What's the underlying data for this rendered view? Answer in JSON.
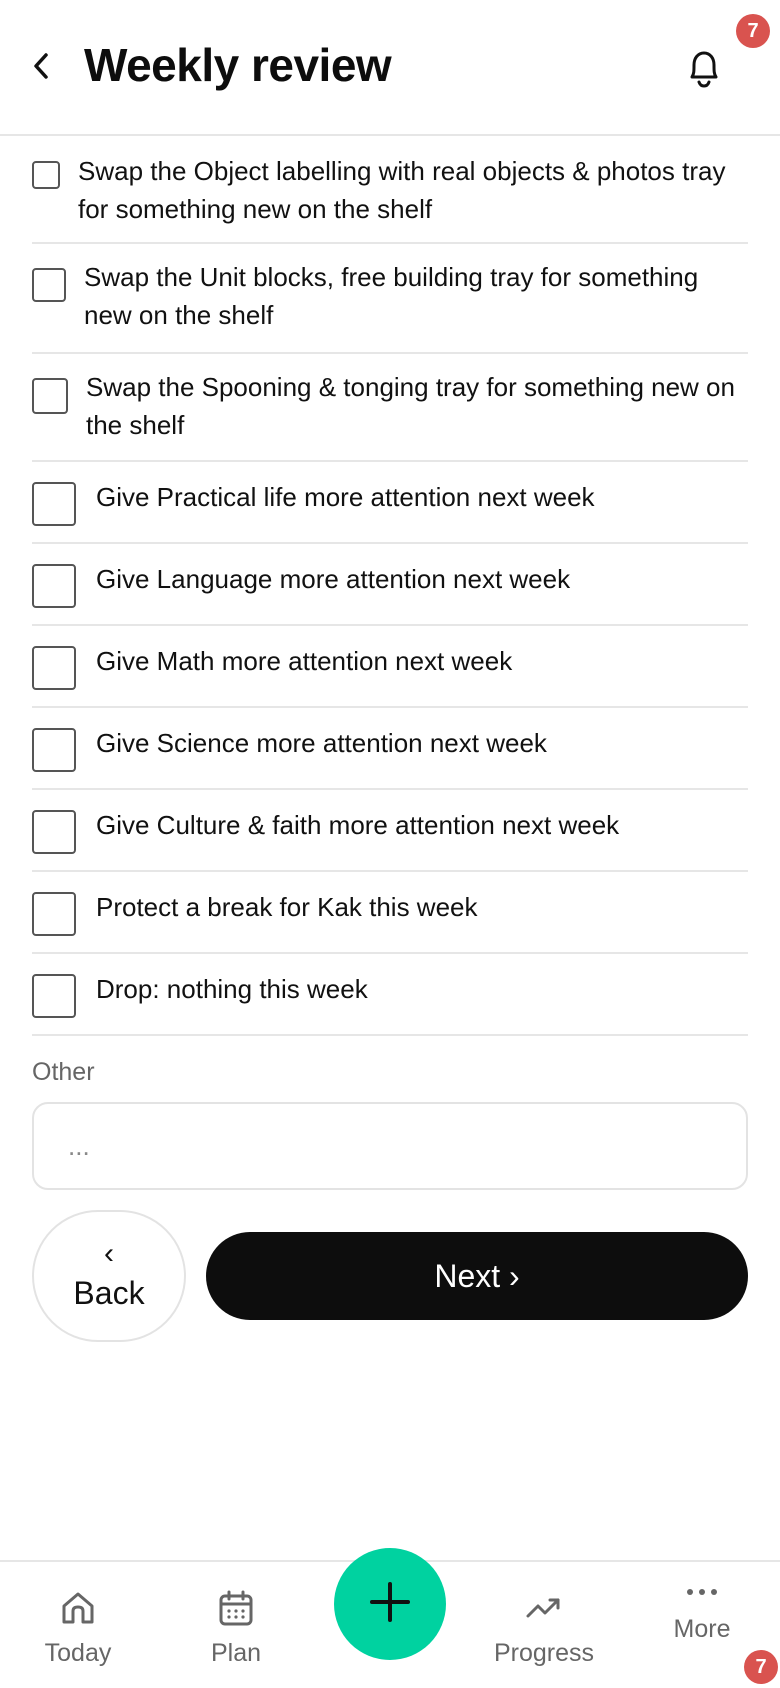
{
  "header": {
    "title": "Weekly review",
    "notification_count": "7"
  },
  "checklist": [
    {
      "label": "Swap the Object labelling with real objects & photos tray for something new on the shelf",
      "checked": false
    },
    {
      "label": "Swap the Unit blocks, free building tray for something new on the shelf",
      "checked": false
    },
    {
      "label": "Swap the Spooning & tonging tray for something new on the shelf",
      "checked": false
    },
    {
      "label": "Give Practical life more attention next week",
      "checked": false
    },
    {
      "label": "Give Language more attention next week",
      "checked": false
    },
    {
      "label": "Give Math more attention next week",
      "checked": false
    },
    {
      "label": "Give Science more attention next week",
      "checked": false
    },
    {
      "label": "Give Culture & faith more attention next week",
      "checked": false
    },
    {
      "label": "Protect a break for Kak this week",
      "checked": false
    },
    {
      "label": "Drop: nothing this week",
      "checked": false
    }
  ],
  "other": {
    "label": "Other",
    "placeholder": "..."
  },
  "buttons": {
    "back_chevron": "‹",
    "back_label": "Back",
    "next_label": "Next ›"
  },
  "bottom_nav": {
    "today": "Today",
    "plan": "Plan",
    "progress": "Progress",
    "more": "More",
    "more_badge": "7"
  },
  "colors": {
    "accent": "#00d2a0",
    "badge": "#d9534f",
    "primary_button": "#0d0d0d"
  }
}
